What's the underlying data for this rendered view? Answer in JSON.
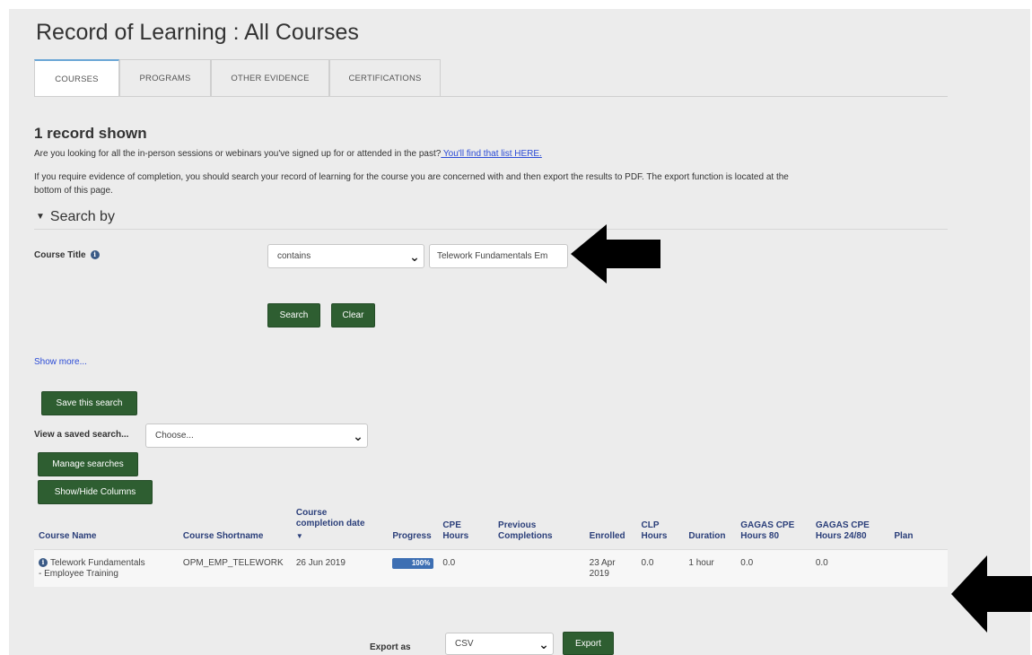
{
  "page": {
    "title": "Record of Learning : All Courses"
  },
  "tabs": [
    {
      "label": "COURSES",
      "active": true
    },
    {
      "label": "PROGRAMS"
    },
    {
      "label": "OTHER EVIDENCE"
    },
    {
      "label": "CERTIFICATIONS"
    }
  ],
  "summary": {
    "records_shown": "1 record shown",
    "intro_question": "Are you looking for all the in-person sessions or webinars you've signed up for or attended in the past?",
    "intro_link": " You'll find that list HERE.",
    "evidence_line1": "If you require evidence of completion, you should search your record of learning for the course you are concerned with and then export the results to PDF.  The export function is located at the",
    "evidence_line2": "bottom of this page."
  },
  "search": {
    "heading": "Search by",
    "course_title_label": "Course Title",
    "operator_value": "contains",
    "query_value": "Telework Fundamentals Em",
    "search_button": "Search",
    "clear_button": "Clear",
    "show_more": "Show more..."
  },
  "saved": {
    "save_button": "Save this search",
    "view_label": "View a saved search...",
    "view_value": "Choose...",
    "manage_button": "Manage searches",
    "columns_button": "Show/Hide Columns"
  },
  "table": {
    "headers": {
      "course_name": "Course Name",
      "course_shortname": "Course Shortname",
      "completion_line1": "Course",
      "completion_line2": "completion date",
      "progress": "Progress",
      "cpe_line1": "CPE",
      "cpe_line2": "Hours",
      "prev_line1": "Previous",
      "prev_line2": "Completions",
      "enrolled": "Enrolled",
      "clp_line1": "CLP",
      "clp_line2": "Hours",
      "duration": "Duration",
      "gagas80_line1": "GAGAS CPE",
      "gagas80_line2": "Hours 80",
      "gagas24_line1": "GAGAS CPE",
      "gagas24_line2": "Hours 24/80",
      "plan": "Plan"
    },
    "rows": [
      {
        "course_name_line1": "Telework Fundamentals",
        "course_name_line2": "- Employee Training",
        "shortname": "OPM_EMP_TELEWORK",
        "completion_date": "26 Jun 2019",
        "progress_label": "100%",
        "progress_percent": 100,
        "cpe_hours": "0.0",
        "previous": "",
        "enrolled_line1": "23 Apr",
        "enrolled_line2": "2019",
        "clp_hours": "0.0",
        "duration": "1 hour",
        "gagas80": "0.0",
        "gagas24": "0.0",
        "plan": ""
      }
    ]
  },
  "export": {
    "label": "Export as",
    "format_value": "CSV",
    "button": "Export"
  },
  "colors": {
    "button_green": "#2e5e31",
    "header_blue": "#2b3f7a",
    "link_blue": "#2b4bd6",
    "progress_blue": "#3d6fb3",
    "tab_active_accent": "#6aa6d6"
  }
}
